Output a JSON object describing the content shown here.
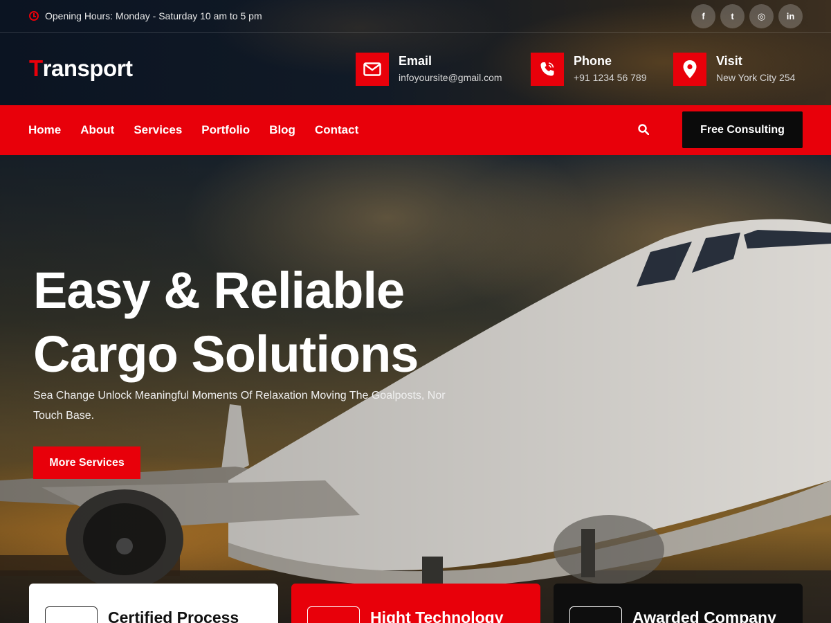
{
  "topbar": {
    "hours": "Opening Hours: Monday - Saturday 10 am to 5 pm",
    "socials": [
      {
        "icon": "facebook-icon",
        "glyph": "f"
      },
      {
        "icon": "twitter-icon",
        "glyph": "t"
      },
      {
        "icon": "instagram-icon",
        "glyph": "◎"
      },
      {
        "icon": "linkedin-icon",
        "glyph": "in"
      }
    ]
  },
  "brand": {
    "logo_first": "T",
    "logo_rest": "ransport"
  },
  "contacts": {
    "email": {
      "title": "Email",
      "value": "infoyoursite@gmail.com"
    },
    "phone": {
      "title": "Phone",
      "value": "+91 1234 56 789"
    },
    "visit": {
      "title": "Visit",
      "value": "New York City 254"
    }
  },
  "nav": {
    "items": [
      "Home",
      "About",
      "Services",
      "Portfolio",
      "Blog",
      "Contact"
    ],
    "cta": "Free Consulting"
  },
  "hero": {
    "title_line1": "Easy & Reliable",
    "title_line2": "Cargo Solutions",
    "subtitle": "Sea Change Unlock Meaningful Moments Of Relaxation Moving The Goalposts, Nor Touch Base.",
    "button": "More Services"
  },
  "features": [
    {
      "title": "Certified Process"
    },
    {
      "title": "Hight Technology"
    },
    {
      "title": "Awarded Company"
    }
  ],
  "colors": {
    "accent": "#e8000a",
    "dark": "#0b0b0b"
  }
}
